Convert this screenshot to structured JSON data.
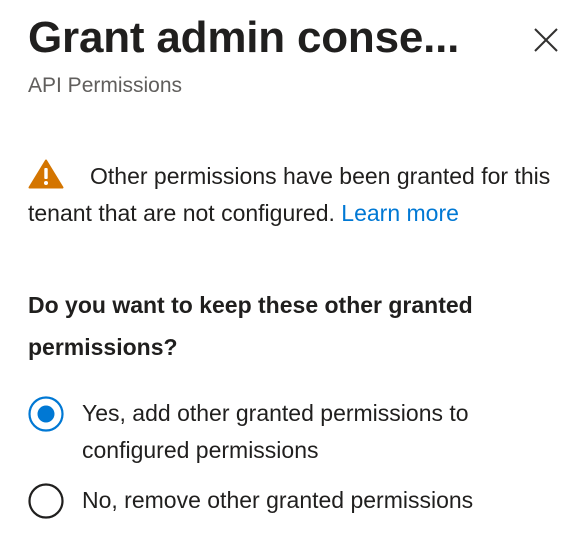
{
  "dialog": {
    "title": "Grant admin conse...",
    "subtitle": "API Permissions",
    "close_icon": "close-icon"
  },
  "warning": {
    "icon": "warning-triangle-icon",
    "text": "Other permissions have been granted for this tenant that are not configured.",
    "link_text": "Learn more",
    "icon_color": "#d47500",
    "link_color": "#0078d4"
  },
  "question": {
    "text": "Do you want to keep these other granted permissions?"
  },
  "options": [
    {
      "label": "Yes, add other granted permissions to configured permissions",
      "selected": true
    },
    {
      "label": "No, remove other granted permissions",
      "selected": false
    }
  ],
  "colors": {
    "accent": "#0078d4",
    "text": "#201f1e",
    "secondary_text": "#605e5c"
  }
}
